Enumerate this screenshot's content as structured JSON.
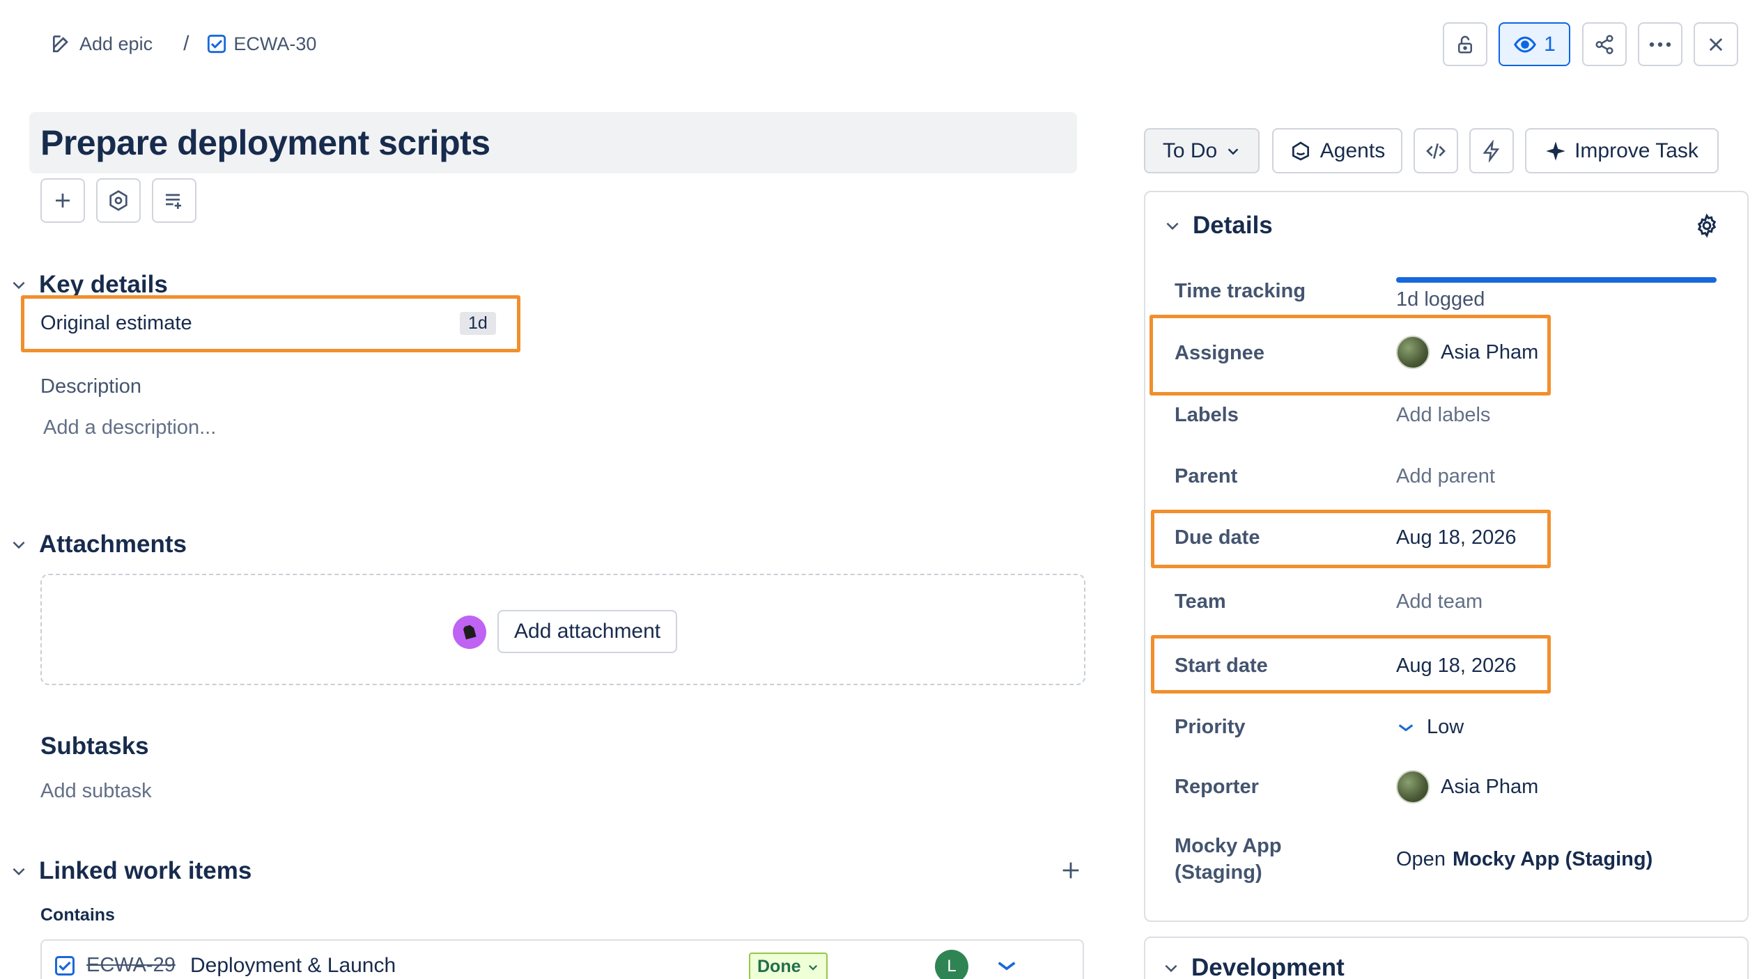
{
  "breadcrumb": {
    "add_epic": "Add epic",
    "separator": "/",
    "issue_key": "ECWA-30"
  },
  "header": {
    "watch_count": "1"
  },
  "title": "Prepare deployment scripts",
  "key_details": {
    "heading": "Key details",
    "original_estimate_label": "Original estimate",
    "original_estimate_value": "1d"
  },
  "description": {
    "label": "Description",
    "placeholder": "Add a description..."
  },
  "attachments": {
    "heading": "Attachments",
    "button": "Add attachment"
  },
  "subtasks": {
    "heading": "Subtasks",
    "add": "Add subtask"
  },
  "linked": {
    "heading": "Linked work items",
    "group": "Contains",
    "items": [
      {
        "key": "ECWA-29",
        "summary": "Deployment & Launch",
        "status": "Done",
        "avatar": "L"
      }
    ]
  },
  "actions": {
    "status": "To Do",
    "agents": "Agents",
    "improve": "Improve Task"
  },
  "details": {
    "heading": "Details",
    "time_tracking_label": "Time tracking",
    "time_tracking_value": "1d logged",
    "time_tracking_fraction": 1.0,
    "assignee_label": "Assignee",
    "assignee_value": "Asia Pham",
    "labels_label": "Labels",
    "labels_value": "Add labels",
    "parent_label": "Parent",
    "parent_value": "Add parent",
    "due_label": "Due date",
    "due_value": "Aug 18, 2026",
    "team_label": "Team",
    "team_value": "Add team",
    "start_label": "Start date",
    "start_value": "Aug 18, 2026",
    "priority_label": "Priority",
    "priority_value": "Low",
    "reporter_label": "Reporter",
    "reporter_value": "Asia Pham",
    "mocky_label_1": "Mocky App",
    "mocky_label_2": "(Staging)",
    "mocky_prefix": "Open",
    "mocky_link": "Mocky App (Staging)"
  },
  "development": {
    "heading": "Development"
  },
  "colors": {
    "highlight": "#f18f2d",
    "accent": "#0c66e4",
    "progress": "#1868db"
  }
}
